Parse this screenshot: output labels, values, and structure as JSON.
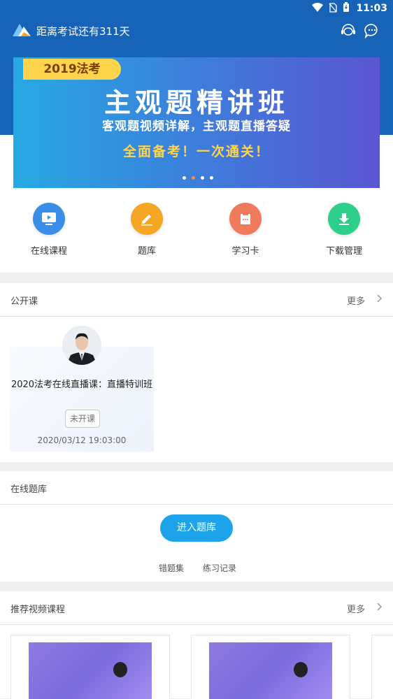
{
  "status_bar": {
    "time": "11:03"
  },
  "header": {
    "countdown": "距离考试还有311天"
  },
  "banner": {
    "tag": "2019法考",
    "title": "主观题精讲班",
    "subtitle": "客观题视频详解，主观题直播答疑",
    "slogan": "全面备考！一次通关！"
  },
  "nav": [
    {
      "label": "在线课程",
      "color": "#3a8ee8"
    },
    {
      "label": "题库",
      "color": "#f5a623"
    },
    {
      "label": "学习卡",
      "color": "#f07a5c"
    },
    {
      "label": "下载管理",
      "color": "#2ecf8a"
    }
  ],
  "public_course": {
    "title": "公开课",
    "more": "更多",
    "card": {
      "title": "2020法考在线直播课：直播特训班",
      "status": "未开课",
      "time": "2020/03/12 19:03:00"
    }
  },
  "question_bank": {
    "title": "在线题库",
    "enter": "进入题库",
    "links": [
      "错题集",
      "练习记录"
    ]
  },
  "recommended": {
    "title": "推荐视频课程",
    "more": "更多"
  },
  "colors": {
    "primary": "#1663b8",
    "accent": "#1ca3ea",
    "banner_yellow": "#ffd44d"
  }
}
